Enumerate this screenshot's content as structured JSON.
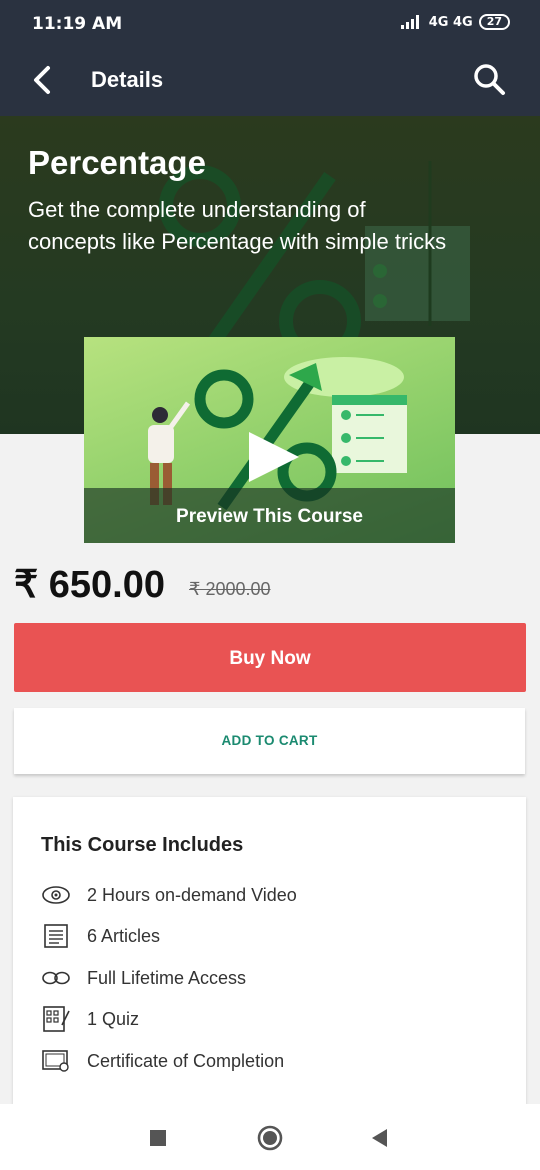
{
  "status_bar": {
    "time": "11:19 AM",
    "network": "4G 4G",
    "battery": "27"
  },
  "app_bar": {
    "title": "Details"
  },
  "hero": {
    "title": "Percentage",
    "description": "Get the complete understanding of concepts like Percentage with simple tricks"
  },
  "preview": {
    "label": "Preview This Course"
  },
  "pricing": {
    "price": "₹ 650.00",
    "original_price": "₹ 2000.00"
  },
  "actions": {
    "buy_label": "Buy Now",
    "cart_label": "ADD TO CART"
  },
  "includes": {
    "heading": "This Course Includes",
    "items": [
      {
        "icon": "eye-icon",
        "label": "2 Hours on-demand Video"
      },
      {
        "icon": "article-icon",
        "label": "6 Articles"
      },
      {
        "icon": "infinity-icon",
        "label": "Full Lifetime Access"
      },
      {
        "icon": "quiz-icon",
        "label": "1 Quiz"
      },
      {
        "icon": "certificate-icon",
        "label": "Certificate of Completion"
      }
    ]
  },
  "colors": {
    "appbar": "#2a3240",
    "buy": "#e95353",
    "cart_text": "#1b8a70"
  }
}
